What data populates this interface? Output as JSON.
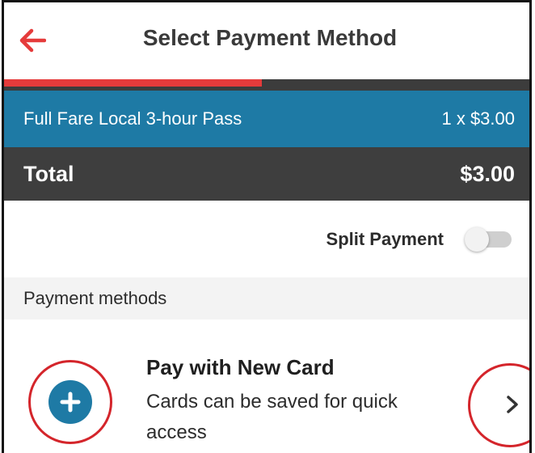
{
  "header": {
    "title": "Select Payment Method",
    "back_icon": "back-arrow-icon",
    "accent_color": "#e53b3b"
  },
  "progress": {
    "value": 0.49
  },
  "fare": {
    "name": "Full Fare Local 3-hour Pass",
    "quantity_price": "1 x $3.00"
  },
  "total": {
    "label": "Total",
    "amount": "$3.00"
  },
  "split_payment": {
    "label": "Split Payment",
    "enabled": false
  },
  "payment_methods": {
    "section_label": "Payment methods",
    "items": [
      {
        "title": "Pay with New Card",
        "subtitle": "Cards can be saved for quick access",
        "icon": "add-circle-icon",
        "chevron": "chevron-right-icon"
      }
    ]
  },
  "colors": {
    "fare_bar": "#1e7aa5",
    "total_bar": "#3e3e3e",
    "highlight_ring": "#d4252b"
  }
}
